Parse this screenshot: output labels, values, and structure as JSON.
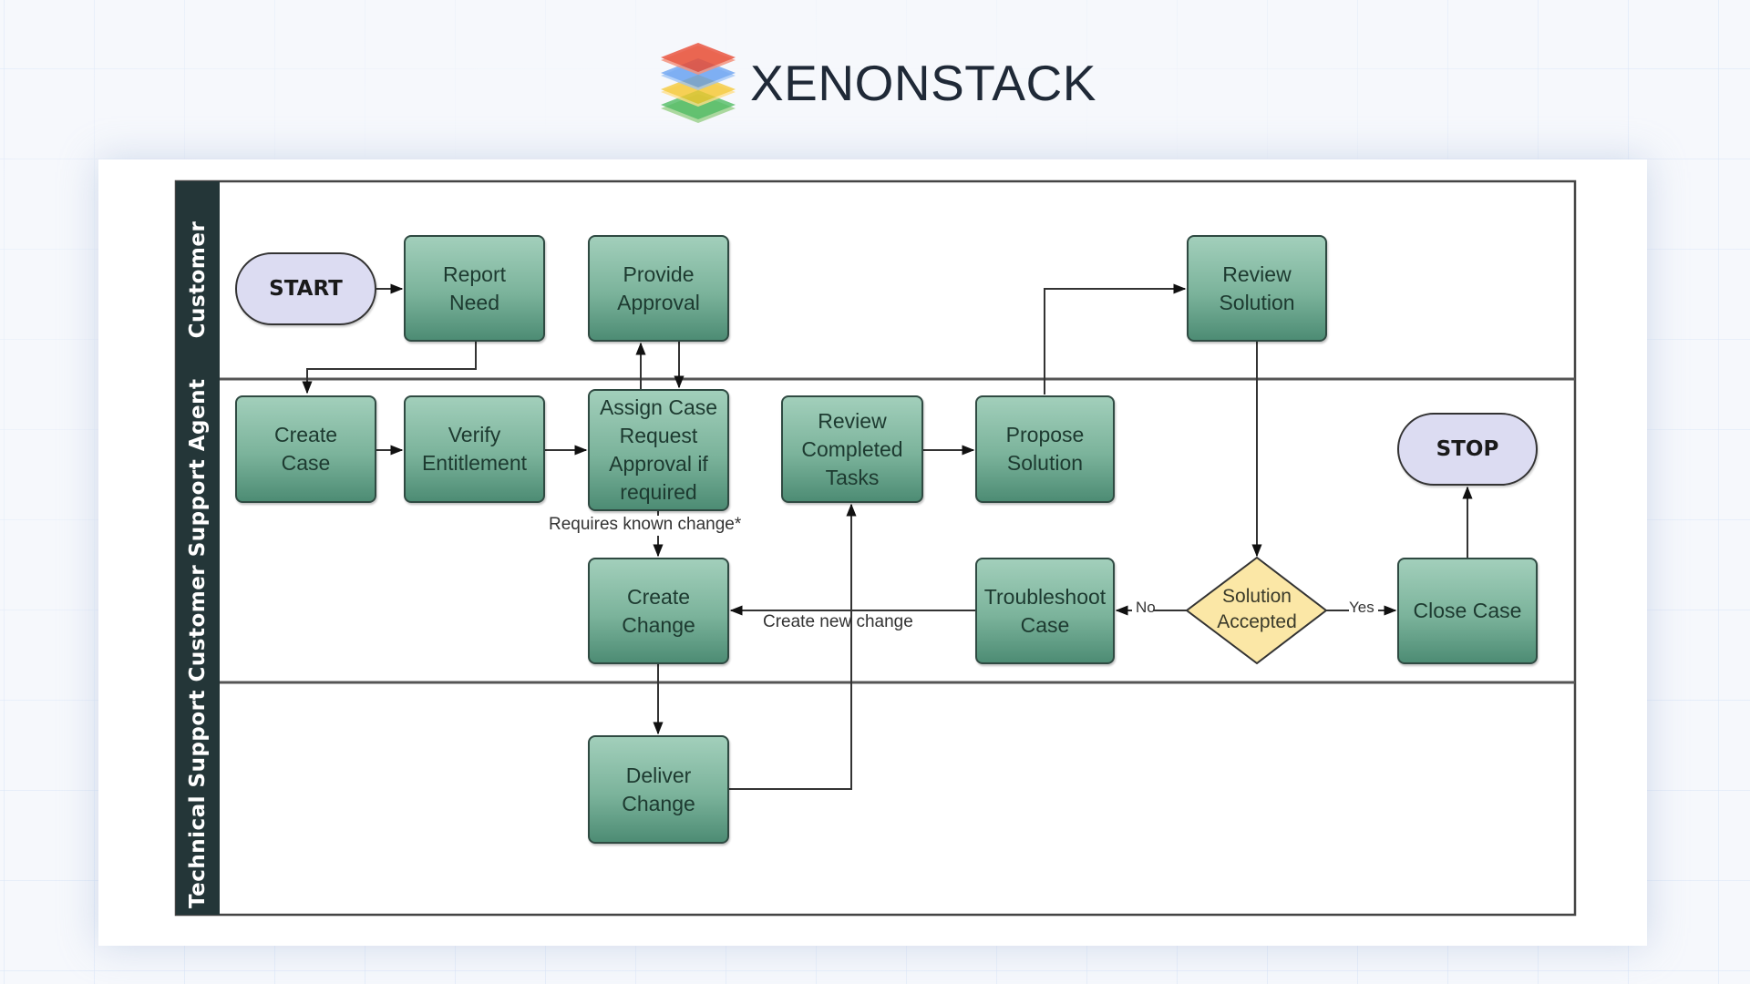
{
  "brand": {
    "name": "XENONSTACK",
    "logo_icon": "stacked-layers-icon",
    "logo_colors": [
      "#e8452c",
      "#4a8ff0",
      "#f5c21b",
      "#35b24a"
    ]
  },
  "diagram": {
    "type": "swimlane-flowchart",
    "lanes": [
      {
        "label": "Customer"
      },
      {
        "label": "Customer Support Agent"
      },
      {
        "label": "Technical Support"
      }
    ],
    "nodes": {
      "start": "START",
      "report_need": "Report\nNeed",
      "provide_approval": "Provide\nApproval",
      "review_solution": "Review\nSolution",
      "create_case": "Create\nCase",
      "verify_entitlement": "Verify\nEntitlement",
      "assign_case": "Assign Case\nRequest\nApproval if\nrequired",
      "review_completed_tasks": "Review\nCompleted\nTasks",
      "propose_solution": "Propose\nSolution",
      "stop": "STOP",
      "create_change": "Create\nChange",
      "troubleshoot_case": "Troubleshoot\nCase",
      "solution_accepted": "Solution\nAccepted",
      "close_case": "Close Case",
      "deliver_change": "Deliver\nChange"
    },
    "edge_labels": {
      "requires_known_change": "Requires known change*",
      "create_new_change": "Create new change",
      "no": "No",
      "yes": "Yes"
    },
    "edges": [
      {
        "from": "START",
        "to": "Report Need"
      },
      {
        "from": "Report Need",
        "to": "Create Case"
      },
      {
        "from": "Create Case",
        "to": "Verify Entitlement"
      },
      {
        "from": "Verify Entitlement",
        "to": "Assign Case Request Approval if required"
      },
      {
        "from": "Assign Case Request Approval if required",
        "to": "Provide Approval"
      },
      {
        "from": "Provide Approval",
        "to": "Assign Case Request Approval if required"
      },
      {
        "from": "Assign Case Request Approval if required",
        "to": "Create Change",
        "label": "Requires known change*"
      },
      {
        "from": "Create Change",
        "to": "Deliver Change"
      },
      {
        "from": "Deliver Change",
        "to": "Review Completed Tasks"
      },
      {
        "from": "Review Completed Tasks",
        "to": "Propose Solution"
      },
      {
        "from": "Propose Solution",
        "to": "Review Solution"
      },
      {
        "from": "Review Solution",
        "to": "Solution Accepted"
      },
      {
        "from": "Solution Accepted",
        "to": "Troubleshoot Case",
        "label": "No"
      },
      {
        "from": "Troubleshoot Case",
        "to": "Create Change",
        "label": "Create new change"
      },
      {
        "from": "Solution Accepted",
        "to": "Close Case",
        "label": "Yes"
      },
      {
        "from": "Close Case",
        "to": "STOP"
      }
    ],
    "colors": {
      "lane_bar": "#243638",
      "process_fill_top": "#a2cfbb",
      "process_fill_bottom": "#4d8c74",
      "terminal_fill": "#dcdcf2",
      "decision_fill": "#fbe7a6"
    }
  }
}
